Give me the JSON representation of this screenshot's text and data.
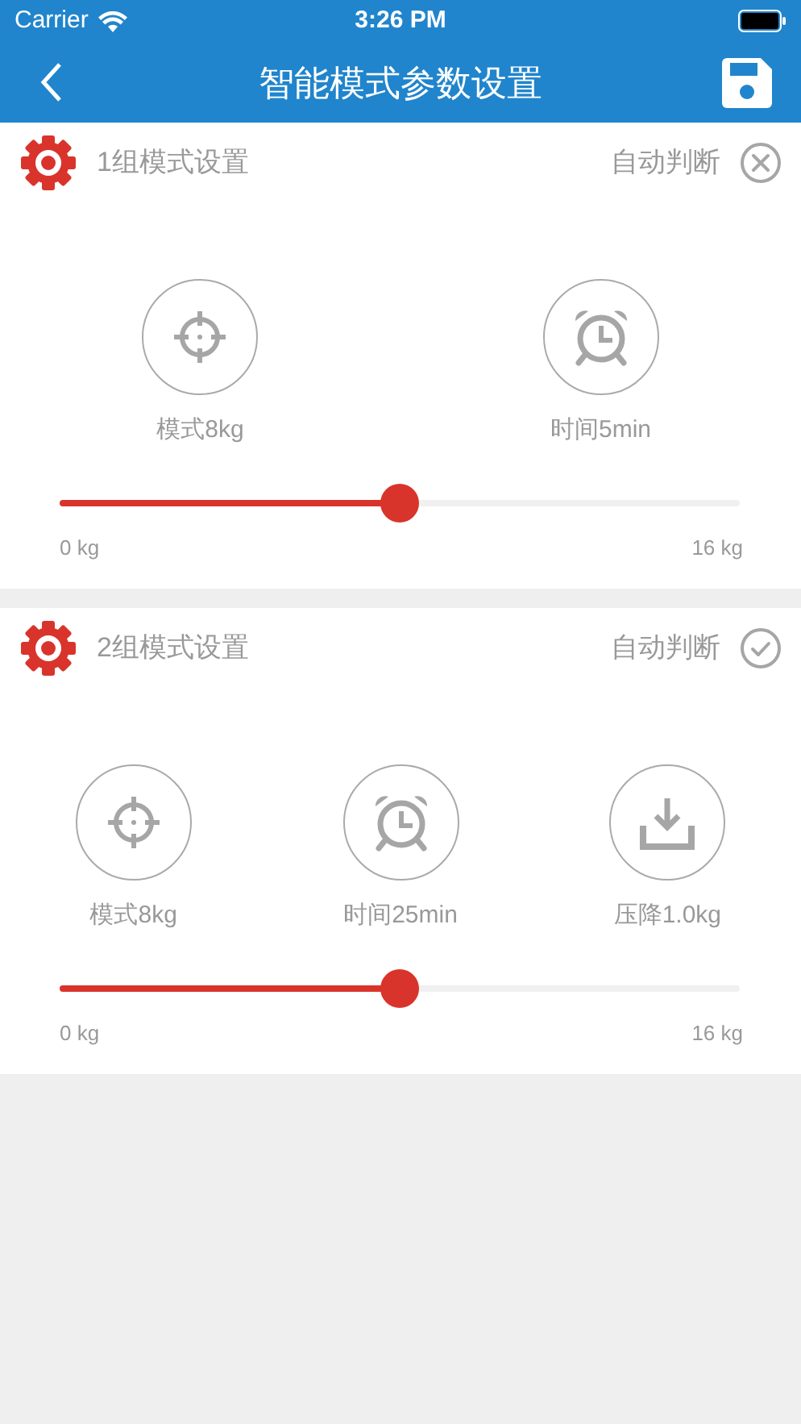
{
  "status_bar": {
    "carrier": "Carrier",
    "time": "3:26 PM"
  },
  "nav": {
    "title": "智能模式参数设置"
  },
  "groups": [
    {
      "title": "1组模式设置",
      "auto_label": "自动判断",
      "checked": false,
      "metrics": [
        {
          "kind": "target",
          "label": "模式8kg"
        },
        {
          "kind": "alarm",
          "label": "时间5min"
        }
      ],
      "slider": {
        "level": 0.5,
        "min_label": "0 kg",
        "max_label": "16 kg"
      }
    },
    {
      "title": "2组模式设置",
      "auto_label": "自动判断",
      "checked": true,
      "metrics": [
        {
          "kind": "target",
          "label": "模式8kg"
        },
        {
          "kind": "alarm",
          "label": "时间25min"
        },
        {
          "kind": "download",
          "label": "压降1.0kg"
        }
      ],
      "slider": {
        "level": 0.5,
        "min_label": "0 kg",
        "max_label": "16 kg"
      }
    }
  ]
}
